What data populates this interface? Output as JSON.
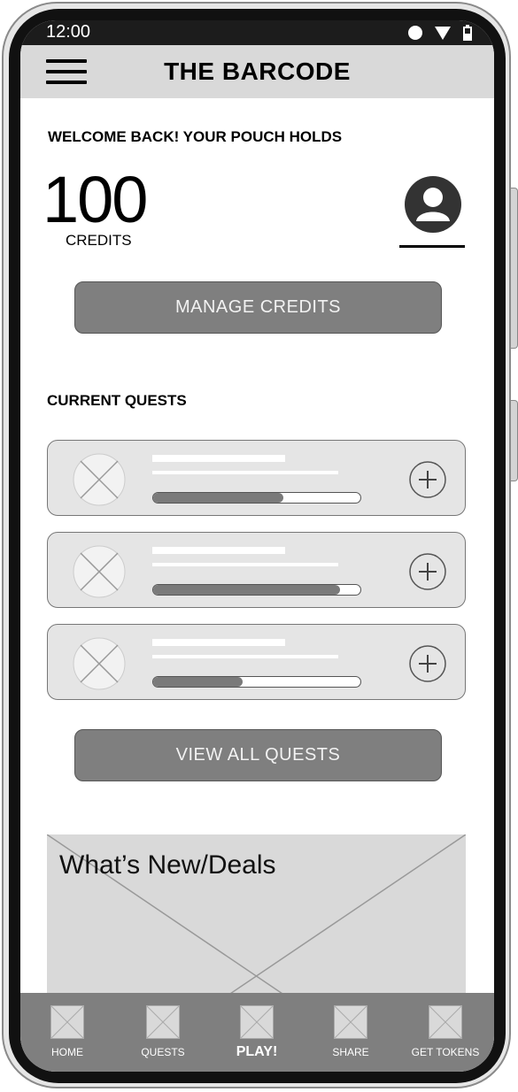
{
  "status_bar": {
    "time": "12:00",
    "icons": [
      "circle-icon",
      "wifi-icon",
      "battery-icon"
    ]
  },
  "app_bar": {
    "title": "THE BARCODE",
    "menu_icon": "hamburger-menu-icon"
  },
  "welcome": {
    "message": "WELCOME BACK! YOUR POUCH HOLDS",
    "credits_value": "100",
    "credits_label": "CREDITS",
    "avatar_icon": "user-avatar-icon"
  },
  "manage_button": {
    "label": "MANAGE CREDITS"
  },
  "quests": {
    "section_title": "CURRENT QUESTS",
    "items": [
      {
        "progress": 0.63,
        "add_icon": "plus-icon"
      },
      {
        "progress": 0.9,
        "add_icon": "plus-icon"
      },
      {
        "progress": 0.43,
        "add_icon": "plus-icon"
      }
    ],
    "view_all_label": "VIEW ALL QUESTS"
  },
  "news": {
    "title": "What’s New/Deals"
  },
  "bottom_nav": {
    "items": [
      {
        "label": "HOME",
        "icon": "home-placeholder-icon"
      },
      {
        "label": "QUESTS",
        "icon": "quests-placeholder-icon"
      },
      {
        "label": "PLAY!",
        "icon": "play-placeholder-icon"
      },
      {
        "label": "SHARE",
        "icon": "share-placeholder-icon"
      },
      {
        "label": "GET TOKENS",
        "icon": "tokens-placeholder-icon"
      }
    ]
  },
  "colors": {
    "button_fill": "#7f7f7f",
    "appbar_bg": "#d9d9d9",
    "card_bg": "#e5e5e5",
    "progress_fill": "#7a7a7a"
  }
}
